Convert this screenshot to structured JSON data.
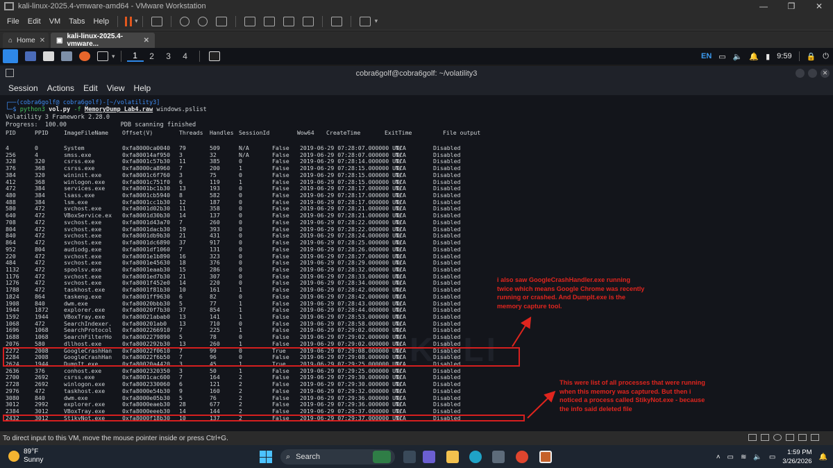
{
  "vmware": {
    "title": "kali-linux-2025.4-vmware-amd64 - VMware Workstation",
    "menus": [
      "File",
      "Edit",
      "VM",
      "Tabs",
      "Help"
    ],
    "tabs": [
      {
        "label": "Home"
      },
      {
        "label": "kali-linux-2025.4-vmware..."
      }
    ],
    "status_text": "To direct input to this VM, move the mouse pointer inside or press Ctrl+G."
  },
  "kali_panel": {
    "workspaces": [
      "1",
      "2",
      "3",
      "4"
    ],
    "keyboard": "EN",
    "time": "9:59"
  },
  "terminal": {
    "title": "cobra6golf@cobra6golf: ~/volatility3",
    "menu": [
      "Session",
      "Actions",
      "Edit",
      "View",
      "Help"
    ],
    "prompt_line1": "┌──(cobra6golf@ cobra6golf)-[~/volatility3]",
    "prompt_line2_prefix": "└─$ ",
    "command_prog": "python3",
    "command_script": "vol.py",
    "command_flag": "-f",
    "command_file": "MemoryDump_Lab4.raw",
    "command_plugin": "windows.pslist",
    "framework_line": "Volatility 3 Framework 2.28.0",
    "progress_line": "Progress:  100.00               PDB scanning finished",
    "header": [
      "PID",
      "PPID",
      "ImageFileName",
      "Offset(V)",
      "Threads",
      "Handles",
      "SessionId",
      "Wow64",
      "CreateTime",
      "ExitTime",
      "File output"
    ],
    "rows": [
      [
        "4",
        "0",
        "System",
        "0xfa8000ca0040",
        "79",
        "509",
        "N/A",
        "False",
        "2019-06-29 07:28:07.000000 UTC",
        "N/A",
        "Disabled"
      ],
      [
        "256",
        "4",
        "smss.exe",
        "0xfa80014af950",
        "3",
        "32",
        "N/A",
        "False",
        "2019-06-29 07:28:07.000000 UTC",
        "N/A",
        "Disabled"
      ],
      [
        "328",
        "320",
        "csrss.exe",
        "0xfa8001c57b30",
        "11",
        "385",
        "0",
        "False",
        "2019-06-29 07:28:14.000000 UTC",
        "N/A",
        "Disabled"
      ],
      [
        "376",
        "368",
        "csrss.exe",
        "0xfa8000ca8960",
        "7",
        "200",
        "1",
        "False",
        "2019-06-29 07:28:15.000000 UTC",
        "N/A",
        "Disabled"
      ],
      [
        "384",
        "320",
        "wininit.exe",
        "0xfa8001c6f760",
        "3",
        "75",
        "0",
        "False",
        "2019-06-29 07:28:15.000000 UTC",
        "N/A",
        "Disabled"
      ],
      [
        "412",
        "368",
        "winlogon.exe",
        "0xfa8001c751f0",
        "6",
        "119",
        "1",
        "False",
        "2019-06-29 07:28:15.000000 UTC",
        "N/A",
        "Disabled"
      ],
      [
        "472",
        "384",
        "services.exe",
        "0xfa8001bc1b30",
        "13",
        "193",
        "0",
        "False",
        "2019-06-29 07:28:17.000000 UTC",
        "N/A",
        "Disabled"
      ],
      [
        "480",
        "384",
        "lsass.exe",
        "0xfa8001cb5940",
        "8",
        "582",
        "0",
        "False",
        "2019-06-29 07:28:17.000000 UTC",
        "N/A",
        "Disabled"
      ],
      [
        "488",
        "384",
        "lsm.exe",
        "0xfa8001cc1b30",
        "12",
        "187",
        "0",
        "False",
        "2019-06-29 07:28:17.000000 UTC",
        "N/A",
        "Disabled"
      ],
      [
        "580",
        "472",
        "svchost.exe",
        "0xfa8001d02b30",
        "11",
        "358",
        "0",
        "False",
        "2019-06-29 07:28:21.000000 UTC",
        "N/A",
        "Disabled"
      ],
      [
        "640",
        "472",
        "VBoxService.ex",
        "0xfa8001d30b30",
        "14",
        "137",
        "0",
        "False",
        "2019-06-29 07:28:21.000000 UTC",
        "N/A",
        "Disabled"
      ],
      [
        "708",
        "472",
        "svchost.exe",
        "0xfa8001d43a70",
        "7",
        "260",
        "0",
        "False",
        "2019-06-29 07:28:22.000000 UTC",
        "N/A",
        "Disabled"
      ],
      [
        "804",
        "472",
        "svchost.exe",
        "0xfa8001dacb30",
        "19",
        "393",
        "0",
        "False",
        "2019-06-29 07:28:22.000000 UTC",
        "N/A",
        "Disabled"
      ],
      [
        "840",
        "472",
        "svchost.exe",
        "0xfa8001db9b30",
        "21",
        "431",
        "0",
        "False",
        "2019-06-29 07:28:24.000000 UTC",
        "N/A",
        "Disabled"
      ],
      [
        "864",
        "472",
        "svchost.exe",
        "0xfa8001dc6890",
        "37",
        "917",
        "0",
        "False",
        "2019-06-29 07:28:25.000000 UTC",
        "N/A",
        "Disabled"
      ],
      [
        "952",
        "804",
        "audiodg.exe",
        "0xfa8001df1060",
        "7",
        "131",
        "0",
        "False",
        "2019-06-29 07:28:26.000000 UTC",
        "N/A",
        "Disabled"
      ],
      [
        "220",
        "472",
        "svchost.exe",
        "0xfa8001e1b890",
        "16",
        "323",
        "0",
        "False",
        "2019-06-29 07:28:27.000000 UTC",
        "N/A",
        "Disabled"
      ],
      [
        "484",
        "472",
        "svchost.exe",
        "0xfa8001e45630",
        "18",
        "376",
        "0",
        "False",
        "2019-06-29 07:28:29.000000 UTC",
        "N/A",
        "Disabled"
      ],
      [
        "1132",
        "472",
        "spoolsv.exe",
        "0xfa8001eaab30",
        "15",
        "286",
        "0",
        "False",
        "2019-06-29 07:28:32.000000 UTC",
        "N/A",
        "Disabled"
      ],
      [
        "1176",
        "472",
        "svchost.exe",
        "0xfa8001ed7b30",
        "21",
        "307",
        "0",
        "False",
        "2019-06-29 07:28:33.000000 UTC",
        "N/A",
        "Disabled"
      ],
      [
        "1276",
        "472",
        "svchost.exe",
        "0xfa8001f452e0",
        "14",
        "220",
        "0",
        "False",
        "2019-06-29 07:28:34.000000 UTC",
        "N/A",
        "Disabled"
      ],
      [
        "1788",
        "472",
        "taskhost.exe",
        "0xfa8001f81b30",
        "10",
        "161",
        "1",
        "False",
        "2019-06-29 07:28:42.000000 UTC",
        "N/A",
        "Disabled"
      ],
      [
        "1824",
        "864",
        "taskeng.exe",
        "0xfa8001ff9630",
        "6",
        "82",
        "0",
        "False",
        "2019-06-29 07:28:42.000000 UTC",
        "N/A",
        "Disabled"
      ],
      [
        "1908",
        "840",
        "dwm.exe",
        "0xfa80020bbb30",
        "5",
        "77",
        "1",
        "False",
        "2019-06-29 07:28:43.000000 UTC",
        "N/A",
        "Disabled"
      ],
      [
        "1944",
        "1872",
        "explorer.exe",
        "0xfa80020f7b30",
        "37",
        "854",
        "1",
        "False",
        "2019-06-29 07:28:44.000000 UTC",
        "N/A",
        "Disabled"
      ],
      [
        "1592",
        "1944",
        "VBoxTray.exe",
        "0xfa80021abab0",
        "13",
        "141",
        "1",
        "False",
        "2019-06-29 07:28:53.000000 UTC",
        "N/A",
        "Disabled"
      ],
      [
        "1068",
        "472",
        "SearchIndexer.",
        "0xfa800201ab0",
        "13",
        "710",
        "0",
        "False",
        "2019-06-29 07:28:58.000000 UTC",
        "N/A",
        "Disabled"
      ],
      [
        "1696",
        "1068",
        "SearchProtocol",
        "0xfa8002266910",
        "7",
        "225",
        "1",
        "False",
        "2019-06-29 07:29:02.000000 UTC",
        "N/A",
        "Disabled"
      ],
      [
        "1688",
        "1068",
        "SearchFilterHo",
        "0xfa8002279890",
        "5",
        "78",
        "0",
        "False",
        "2019-06-29 07:29:02.000000 UTC",
        "N/A",
        "Disabled"
      ],
      [
        "2076",
        "580",
        "dllhost.exe",
        "0xfa8002292b30",
        "13",
        "260",
        "1",
        "False",
        "2019-06-29 07:29:02.000000 UTC",
        "N/A",
        "Disabled"
      ],
      [
        "2272",
        "2008",
        "GoogleCrashHan",
        "0xfa80022f0610",
        "7",
        "99",
        "0",
        "True",
        "2019-06-29 07:29:08.000000 UTC",
        "N/A",
        "Disabled"
      ],
      [
        "2284",
        "2008",
        "GoogleCrashHan",
        "0xfa80022f6b50",
        "7",
        "96",
        "0",
        "False",
        "2019-06-29 07:29:08.000000 UTC",
        "N/A",
        "Disabled"
      ],
      [
        "2624",
        "1944",
        "DumpIt.exe",
        "0xfa80020a4420",
        "3",
        "45",
        "1",
        "True",
        "2019-06-29 07:29:25.000000 UTC",
        "N/A",
        "Disabled"
      ],
      [
        "2636",
        "376",
        "conhost.exe",
        "0xfa8002320350",
        "3",
        "50",
        "1",
        "False",
        "2019-06-29 07:29:25.000000 UTC",
        "N/A",
        "Disabled"
      ],
      [
        "2700",
        "2692",
        "csrss.exe",
        "0xfa8001cac600",
        "7",
        "164",
        "2",
        "False",
        "2019-06-29 07:29:30.000000 UTC",
        "N/A",
        "Disabled"
      ],
      [
        "2728",
        "2692",
        "winlogon.exe",
        "0xfa8002330060",
        "6",
        "121",
        "2",
        "False",
        "2019-06-29 07:29:30.000000 UTC",
        "N/A",
        "Disabled"
      ],
      [
        "2976",
        "472",
        "taskhost.exe",
        "0xfa8000e54b30",
        "9",
        "160",
        "2",
        "False",
        "2019-06-29 07:29:32.000000 UTC",
        "N/A",
        "Disabled"
      ],
      [
        "3080",
        "840",
        "dwm.exe",
        "0xfa8000e05b30",
        "5",
        "76",
        "2",
        "False",
        "2019-06-29 07:29:36.000000 UTC",
        "N/A",
        "Disabled"
      ],
      [
        "3012",
        "2992",
        "explorer.exe",
        "0xfa8000eaeb30",
        "28",
        "677",
        "2",
        "False",
        "2019-06-29 07:29:36.000000 UTC",
        "N/A",
        "Disabled"
      ],
      [
        "2384",
        "3012",
        "VBoxTray.exe",
        "0xfa8000eeeb30",
        "14",
        "144",
        "2",
        "False",
        "2019-06-29 07:29:37.000000 UTC",
        "N/A",
        "Disabled"
      ],
      [
        "2432",
        "3012",
        "StikyNot.exe",
        "0xfa8000f18b30",
        "10",
        "137",
        "2",
        "False",
        "2019-06-29 07:29:37.000000 UTC",
        "N/A",
        "Disabled"
      ]
    ],
    "watermark": "KALI"
  },
  "annotations": {
    "note1": [
      "i also saw GoogleCrashHandler.exe running",
      "twice which means Google Chrome was recently",
      "running or crashed. And DumpIt.exe is the",
      "memory capture tool."
    ],
    "note2": [
      "This were list of all processes that were running",
      "when this memory was captured. But then i",
      "noticed a process called StikyNot.exe - because",
      "the info said deleted file"
    ],
    "color": "#e0251e"
  },
  "taskbar": {
    "weather_temp": "89°F",
    "weather_desc": "Sunny",
    "search_label": "Search",
    "time": "1:59 PM",
    "date": "3/26/2026"
  }
}
